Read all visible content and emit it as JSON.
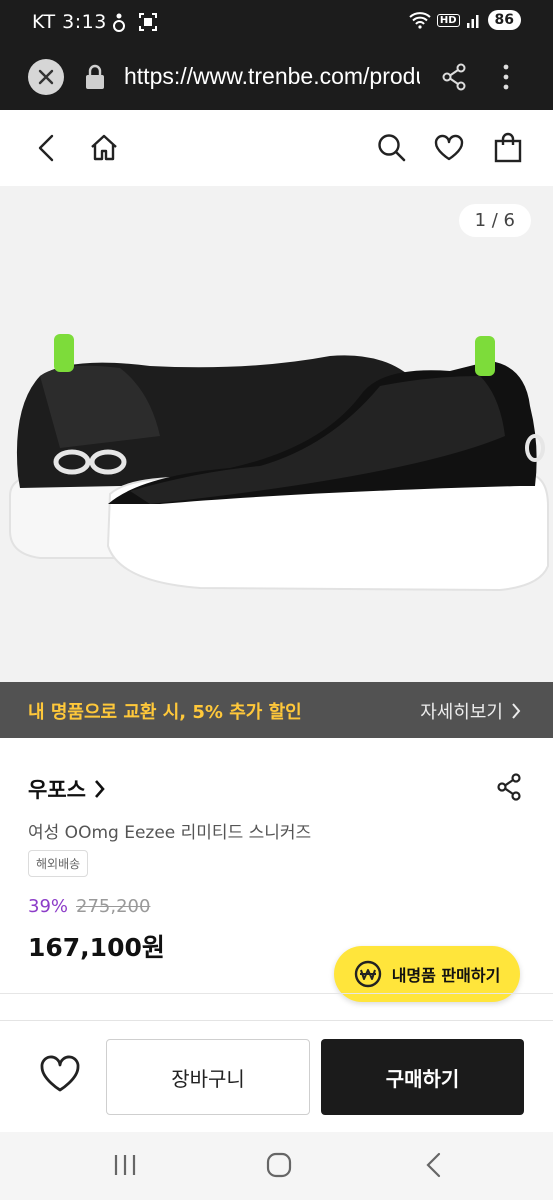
{
  "status_bar": {
    "carrier": "KT",
    "time": "3:13",
    "network": "HD",
    "battery": "86"
  },
  "browser": {
    "url": "https://www.trenbe.com/product"
  },
  "gallery": {
    "counter": "1 / 6"
  },
  "promo": {
    "text": "내 명품으로 교환 시, 5% 추가 할인",
    "link_label": "자세히보기"
  },
  "product": {
    "brand": "우포스",
    "name": "여성 OOmg Eezee 리미티드 스니커즈",
    "shipping_tag": "해외배송",
    "discount": "39%",
    "original_price": "275,200",
    "price": "167,100원",
    "sell_button_label": "내명품 판매하기"
  },
  "actions": {
    "cart_label": "장바구니",
    "buy_label": "구매하기"
  },
  "colors": {
    "promo_text": "#ffc83a",
    "discount": "#8c3cc8",
    "sell_button": "#ffe53b",
    "buy_button": "#1b1b1b"
  }
}
